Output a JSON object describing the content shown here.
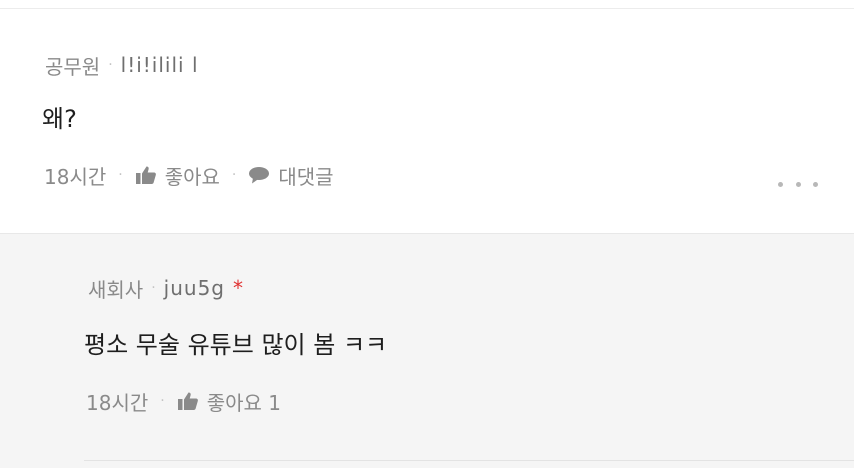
{
  "comment": {
    "author_company": "공무원",
    "author_nick": "l!i!ilili l",
    "body": "왜?",
    "time": "18시간",
    "like_label": "좋아요",
    "reply_label": "대댓글",
    "more_icon": "more-horizontal-icon"
  },
  "reply": {
    "author_company": "새회사",
    "author_nick": "juu5g",
    "author_marker": "*",
    "body": "평소 무술 유튜브 많이 봄 ㅋㅋ",
    "time": "18시간",
    "like_label": "좋아요 1"
  },
  "icons": {
    "like": "thumbs-up-icon",
    "reply": "speech-bubble-icon"
  },
  "colors": {
    "meta_text": "#8a8a8a",
    "body_text": "#1e1e1e",
    "reply_background": "#f5f5f5",
    "marker": "#e03131"
  }
}
